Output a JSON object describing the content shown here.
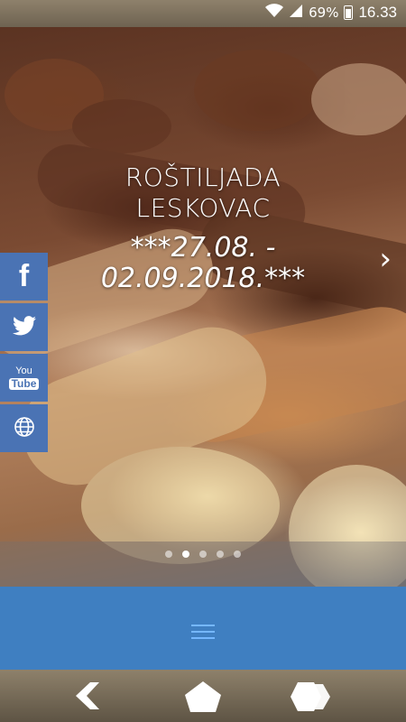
{
  "status_bar": {
    "battery": "69%",
    "time": "16.33",
    "icons": [
      "wifi-icon",
      "signal-icon",
      "battery-icon"
    ]
  },
  "slider": {
    "title_line1": "ROŠTILJADA",
    "title_line2": "LESKOVAC",
    "date_line1": "***27.08. -",
    "date_line2": "02.09.2018.***",
    "prev_arrow": "‹",
    "next_arrow": "›",
    "slide_count": 5,
    "active_slide": 2
  },
  "social": [
    {
      "name": "facebook",
      "label": "f"
    },
    {
      "name": "twitter",
      "label": ""
    },
    {
      "name": "youtube",
      "label_top": "You",
      "label_bottom": "Tube"
    },
    {
      "name": "website",
      "label": ""
    }
  ],
  "colors": {
    "accent_blue": "#3f7fc1",
    "social_blue": "#4a73b4",
    "menu_icon": "#75b7ff"
  }
}
